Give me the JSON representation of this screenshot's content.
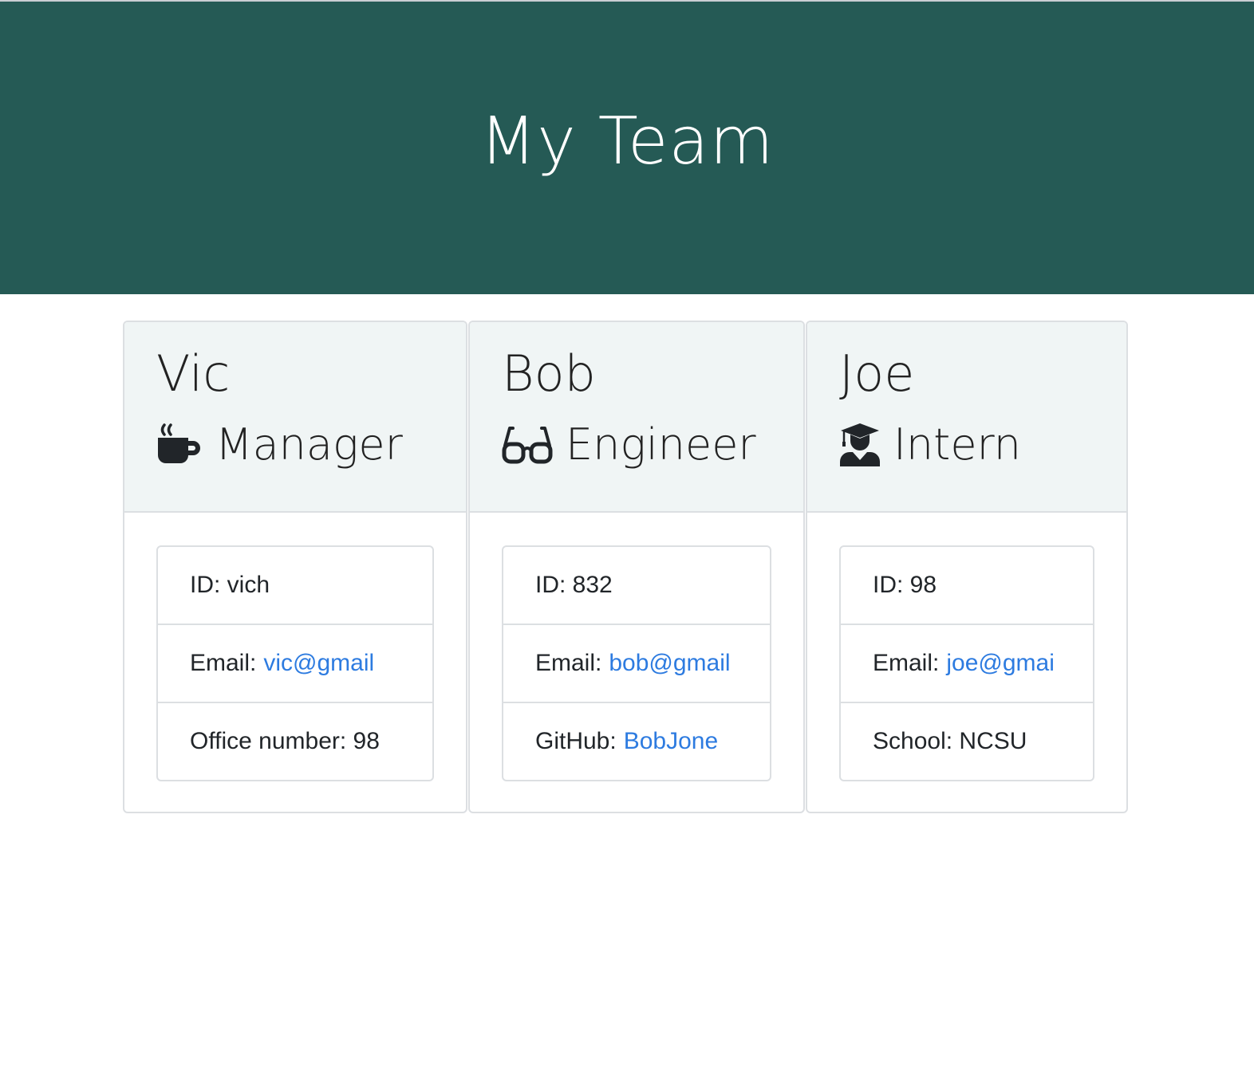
{
  "page": {
    "title": "My Team"
  },
  "colors": {
    "header_bg": "#255a55",
    "card_header_bg": "#f0f5f5",
    "link": "#2d7be0"
  },
  "employees": [
    {
      "name": "Vic",
      "role": "Manager",
      "icon": "mug-icon",
      "id_label": "ID: vich",
      "email_prefix": "Email:",
      "email": "vic@gmail",
      "extra_label": "Office number: 98"
    },
    {
      "name": "Bob",
      "role": "Engineer",
      "icon": "glasses-icon",
      "id_label": "ID: 832",
      "email_prefix": "Email:",
      "email": "bob@gmail",
      "extra_prefix": "GitHub:",
      "github": "BobJone"
    },
    {
      "name": "Joe",
      "role": "Intern",
      "icon": "graduate-icon",
      "id_label": "ID: 98",
      "email_prefix": "Email:",
      "email": "joe@gmai",
      "extra_label": "School: NCSU"
    }
  ]
}
